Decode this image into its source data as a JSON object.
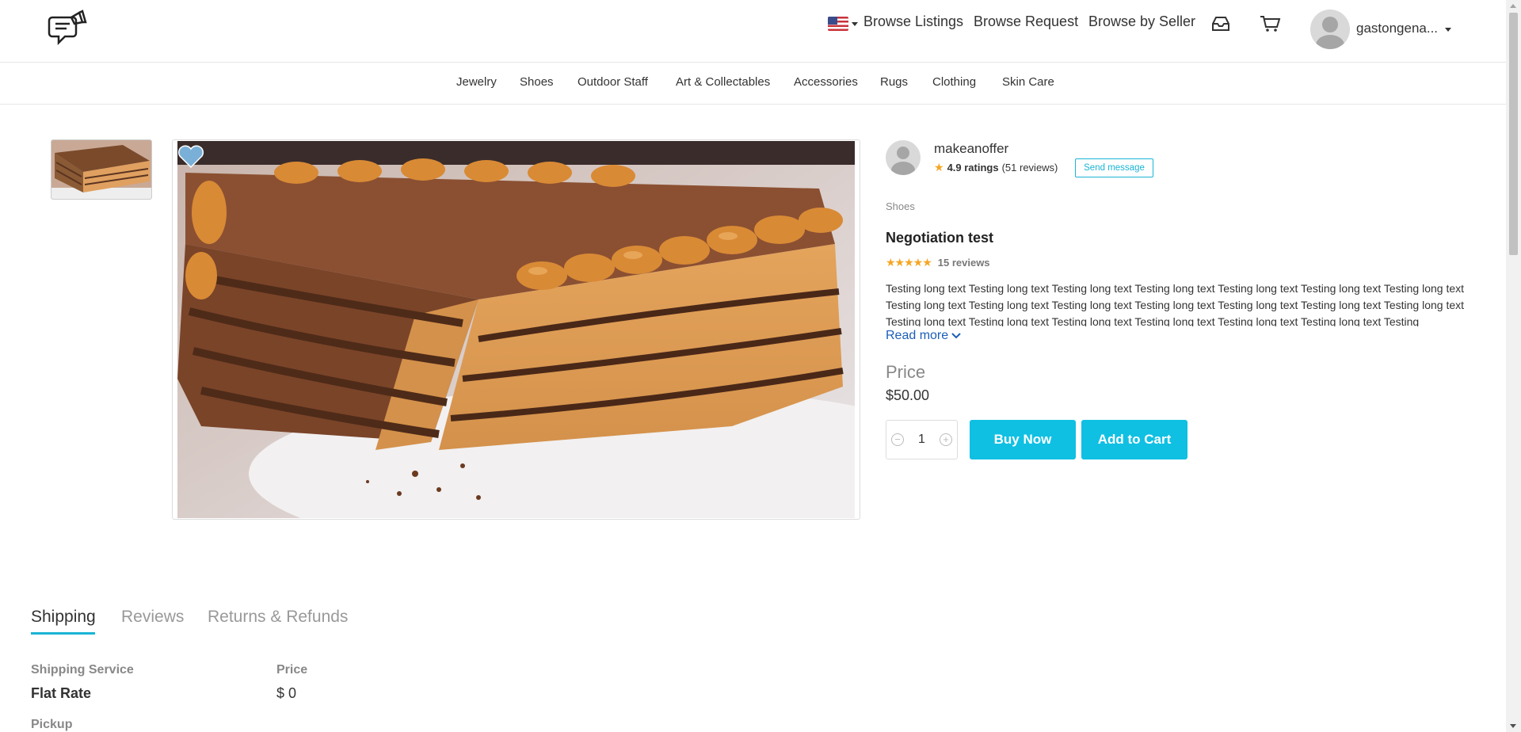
{
  "header": {
    "flag_icon": "us-flag-icon",
    "links": [
      "Browse Listings",
      "Browse Request",
      "Browse by Seller"
    ],
    "icons": [
      "inbox-icon",
      "cart-icon"
    ],
    "username": "gastongena..."
  },
  "categories": [
    "Jewelry",
    "Shoes",
    "Outdoor Staff",
    "Art & Collectables",
    "Accessories",
    "Rugs",
    "Clothing",
    "Skin Care"
  ],
  "seller": {
    "name": "makeanoffer",
    "rating": "4.9 ratings",
    "reviews": "(51 reviews)",
    "send_message": "Send message"
  },
  "product": {
    "category": "Shoes",
    "title": "Negotiation test",
    "stars": "★★★★★",
    "reviews_count": "15 reviews",
    "description": "Testing long text Testing long text Testing long text Testing long text Testing long text Testing long text Testing long text Testing long text Testing long text Testing long text Testing long text Testing long text Testing long text Testing long text Testing long text Testing long text Testing long text Testing long text Testing long text Testing long text Testing",
    "read_more": "Read more",
    "price_label": "Price",
    "price": "$50.00",
    "quantity": "1",
    "buy_now": "Buy Now",
    "add_to_cart": "Add to Cart"
  },
  "tabs": [
    "Shipping",
    "Reviews",
    "Returns & Refunds"
  ],
  "shipping": {
    "service_header": "Shipping Service",
    "price_header": "Price",
    "service": "Flat Rate",
    "price": "$ 0",
    "pickup": "Pickup"
  },
  "colors": {
    "accent": "#0fc0e3",
    "link": "#1c5fb8",
    "star": "#f5a623"
  }
}
